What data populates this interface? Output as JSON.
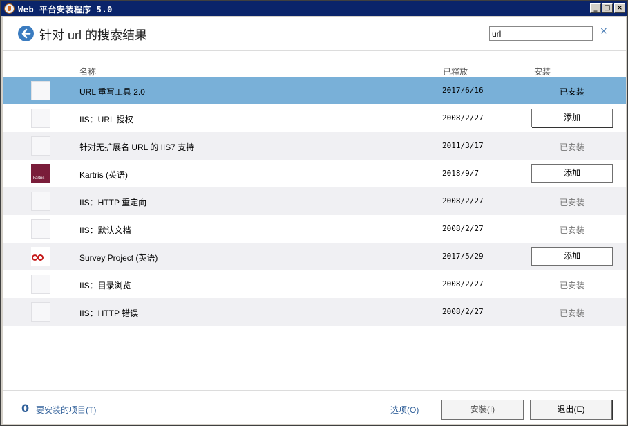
{
  "window": {
    "title": "Web 平台安装程序 5.0"
  },
  "header": {
    "title": "针对 url 的搜索结果",
    "search_value": "url",
    "clear_symbol": "×"
  },
  "columns": {
    "name": "名称",
    "released": "已释放",
    "install": "安装"
  },
  "rows": [
    {
      "icon": "package-placeholder-icon",
      "name": "URL 重写工具 2.0",
      "date": "2017/6/16",
      "action": "已安装",
      "action_type": "status",
      "selected": true
    },
    {
      "icon": "package-placeholder-icon",
      "name": "IIS：URL 授权",
      "date": "2008/2/27",
      "action": "添加",
      "action_type": "button"
    },
    {
      "icon": "package-placeholder-icon",
      "name": "针对无扩展名 URL 的 IIS7 支持",
      "date": "2011/3/17",
      "action": "已安装",
      "action_type": "status"
    },
    {
      "icon": "kartris-logo-icon",
      "name": "Kartris (英语)",
      "date": "2018/9/7",
      "action": "添加",
      "action_type": "button"
    },
    {
      "icon": "package-placeholder-icon",
      "name": "IIS：HTTP 重定向",
      "date": "2008/2/27",
      "action": "已安装",
      "action_type": "status"
    },
    {
      "icon": "package-placeholder-icon",
      "name": "IIS：默认文档",
      "date": "2008/2/27",
      "action": "已安装",
      "action_type": "status"
    },
    {
      "icon": "survey-project-logo-icon",
      "name": "Survey Project (英语)",
      "date": "2017/5/29",
      "action": "添加",
      "action_type": "button"
    },
    {
      "icon": "package-placeholder-icon",
      "name": "IIS：目录浏览",
      "date": "2008/2/27",
      "action": "已安装",
      "action_type": "status"
    },
    {
      "icon": "package-placeholder-icon",
      "name": "IIS：HTTP 错误",
      "date": "2008/2/27",
      "action": "已安装",
      "action_type": "status"
    }
  ],
  "footer": {
    "count": "0",
    "items_link": "要安装的项目(T)",
    "options_link": "选项(O)",
    "install_button": "安装(I)",
    "exit_button": "退出(E)"
  },
  "colors": {
    "title_bar": "#0a246a",
    "selected_row": "#79b0d8",
    "link": "#2f5f99",
    "accent": "#3b7cc0"
  }
}
